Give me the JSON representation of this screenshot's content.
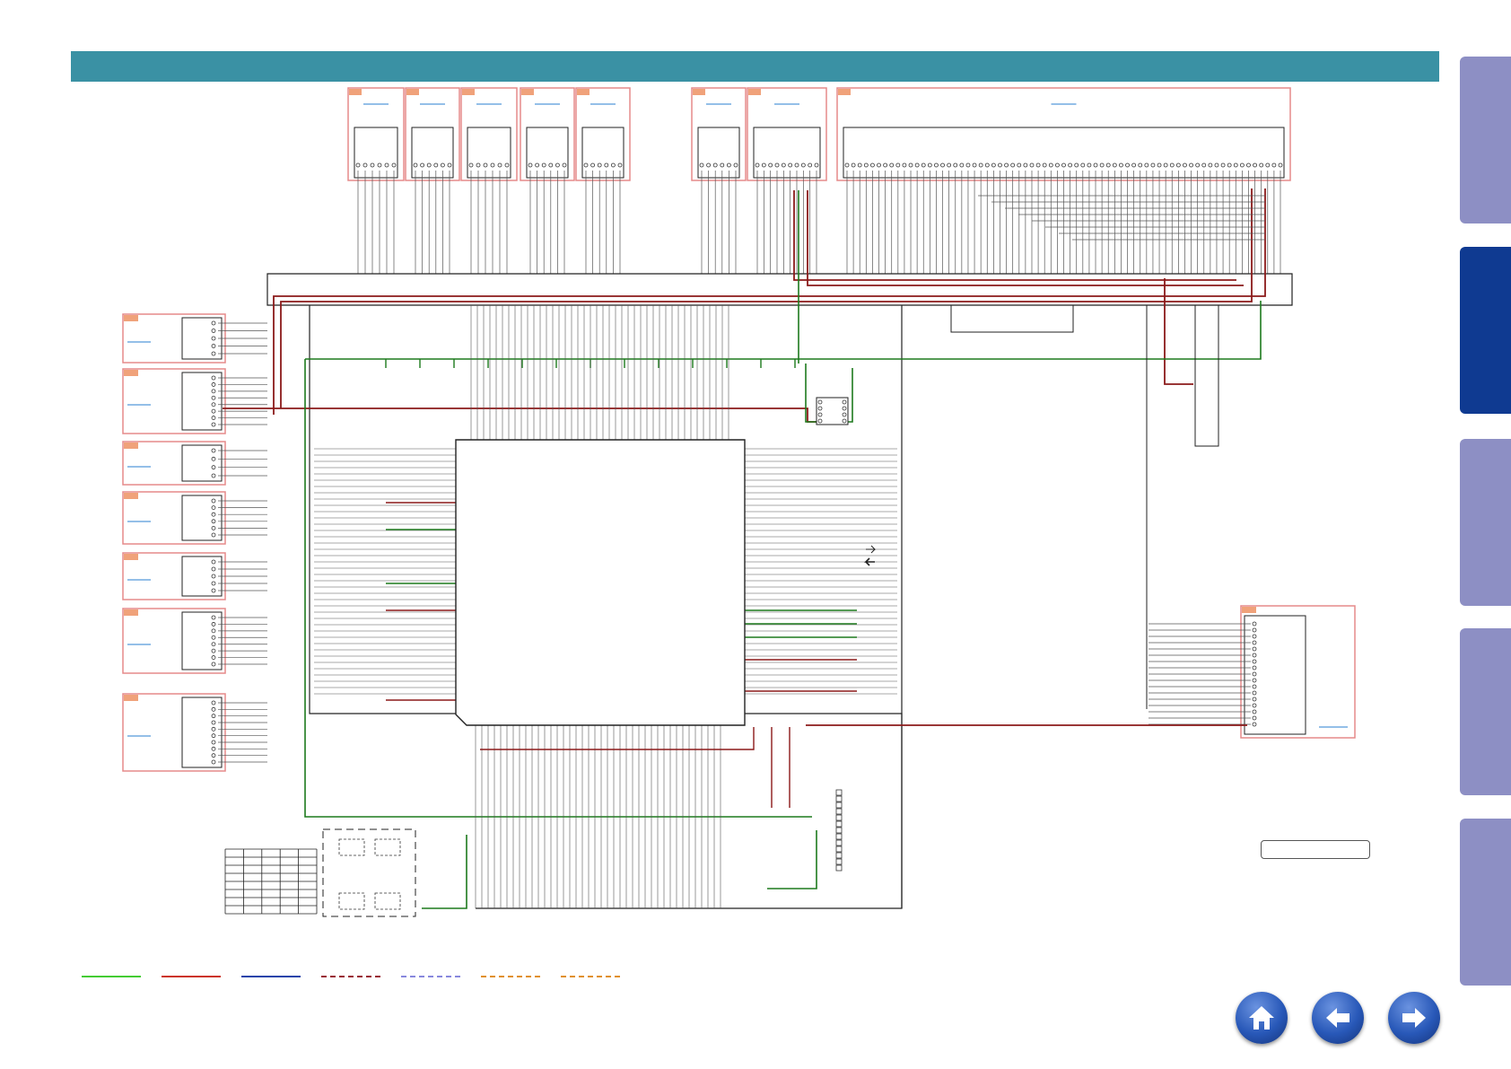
{
  "header": {
    "title": ""
  },
  "side_tabs": [
    {
      "id": "tab-1",
      "active": false
    },
    {
      "id": "tab-2",
      "active": true
    },
    {
      "id": "tab-3",
      "active": false
    },
    {
      "id": "tab-4",
      "active": false
    },
    {
      "id": "tab-5",
      "active": false
    }
  ],
  "colors": {
    "header": "#3a91a4",
    "tab": "#8d8fc4",
    "tab_active": "#0f3a91",
    "connector_box": "#e58a8a",
    "connector_tag": "#f0a27a",
    "wire": "#555555",
    "signal_green": "#1d7a1d",
    "signal_red": "#8b1a1a",
    "link_blue": "#2a7fd1"
  },
  "legend": [
    {
      "style": "solid",
      "color": "#44cc33"
    },
    {
      "style": "solid",
      "color": "#cc3322"
    },
    {
      "style": "solid",
      "color": "#2244aa"
    },
    {
      "style": "dashed",
      "color": "#992233"
    },
    {
      "style": "dashed",
      "color": "#8888dd"
    },
    {
      "style": "dashed",
      "color": "#e0902a"
    },
    {
      "style": "dashed",
      "color": "#e0902a"
    }
  ],
  "nav": {
    "home_icon": "home-icon",
    "back_icon": "arrow-left-icon",
    "forward_icon": "arrow-right-icon"
  }
}
